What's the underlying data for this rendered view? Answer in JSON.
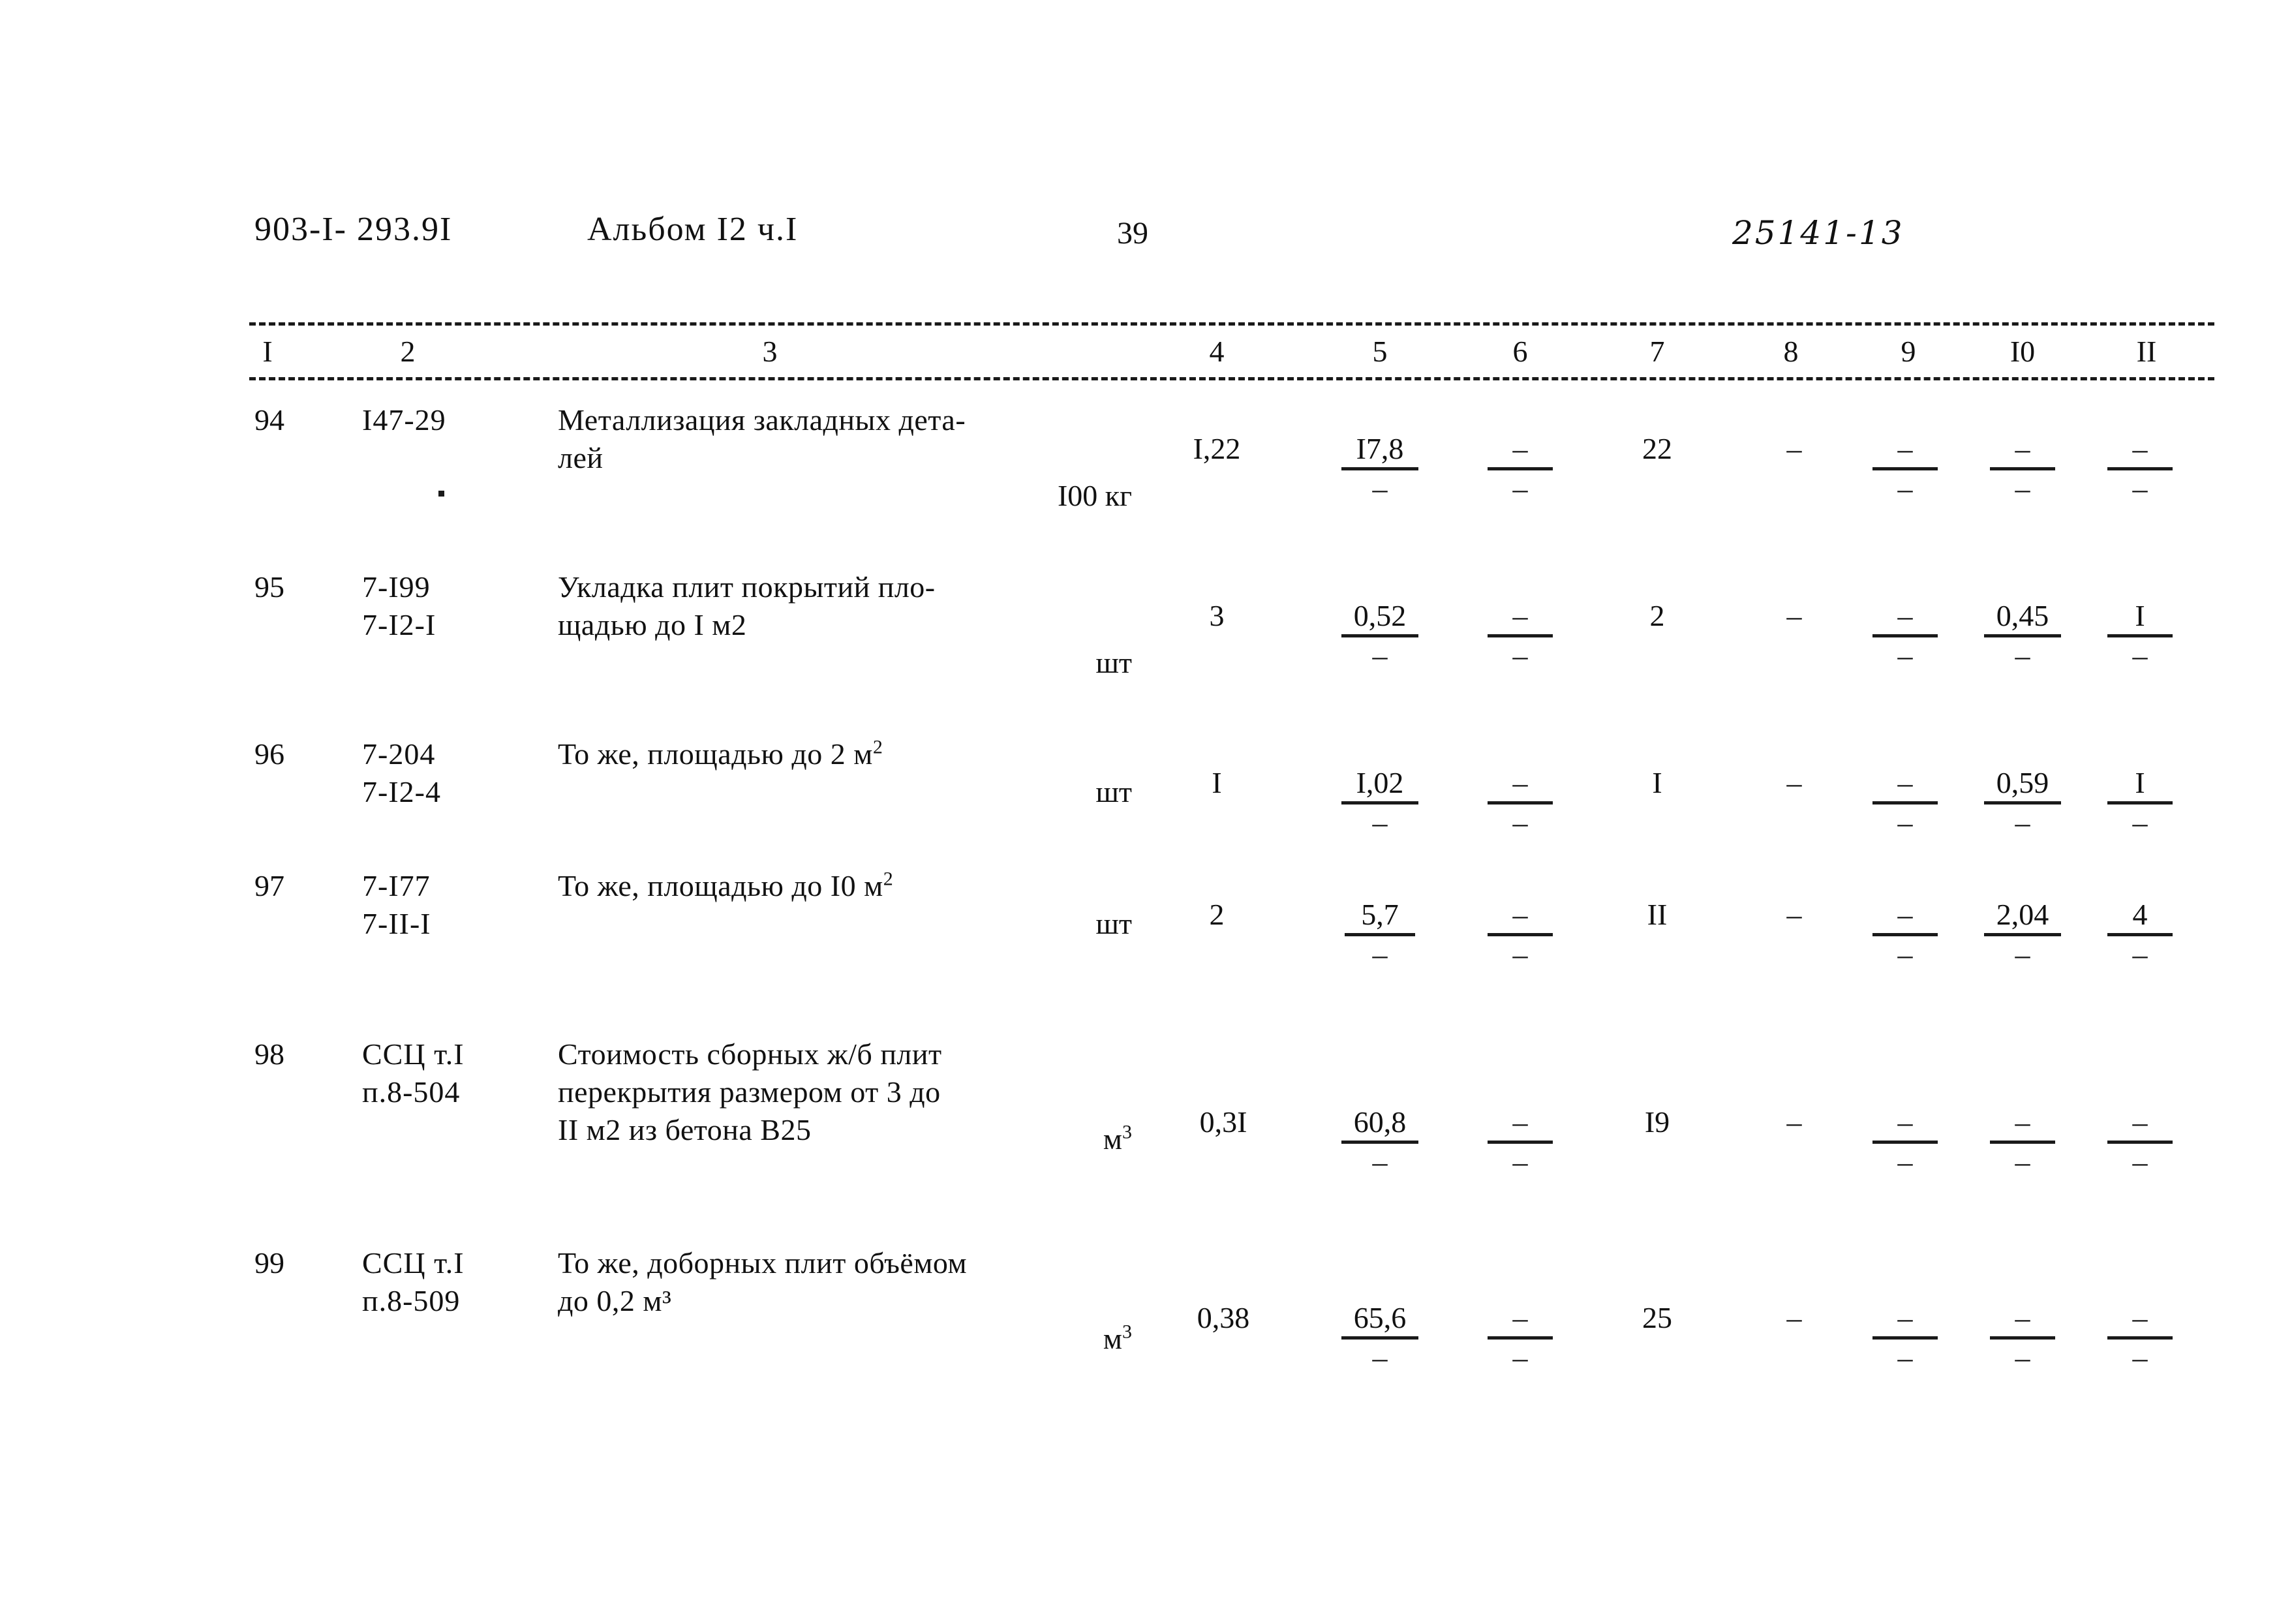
{
  "header": {
    "doc_code": "903-I- 293.9I",
    "album": "Альбом I2 ч.I",
    "page_number": "39",
    "stamp": "25141-13"
  },
  "table": {
    "column_headers": [
      "I",
      "2",
      "3",
      "4",
      "5",
      "6",
      "7",
      "8",
      "9",
      "I0",
      "II"
    ],
    "rows": [
      {
        "num": "94",
        "code_line1": "I47-29",
        "code_line2": "",
        "text_line1": "Металлизация закладных дета-",
        "text_line2": "лей",
        "text_line3": "",
        "unit": "I00 кг",
        "unit_sup": "",
        "col4": "I,22",
        "col5_num": "I7,8",
        "col5_den": "–",
        "col6_num": "–",
        "col6_den": "–",
        "col7": "22",
        "col8": "–",
        "col9_num": "–",
        "col9_den": "–",
        "col10_num": "–",
        "col10_den": "–",
        "col11_num": "–",
        "col11_den": "–"
      },
      {
        "num": "95",
        "code_line1": "7-I99",
        "code_line2": "7-I2-I",
        "text_line1": "Укладка плит покрытий пло-",
        "text_line2": "щадью до I м2",
        "text_line3": "",
        "unit": "шт",
        "unit_sup": "",
        "col4": "3",
        "col5_num": "0,52",
        "col5_den": "–",
        "col6_num": "–",
        "col6_den": "–",
        "col7": "2",
        "col8": "–",
        "col9_num": "–",
        "col9_den": "–",
        "col10_num": "0,45",
        "col10_den": "–",
        "col11_num": "I",
        "col11_den": "–"
      },
      {
        "num": "96",
        "code_line1": "7-204",
        "code_line2": "7-I2-4",
        "text_line1": "То же, площадью до 2 м",
        "text_line2": "",
        "text_line3": "",
        "unit": "шт",
        "unit_sup": "2",
        "col4": "I",
        "col5_num": "I,02",
        "col5_den": "–",
        "col6_num": "–",
        "col6_den": "–",
        "col7": "I",
        "col8": "–",
        "col9_num": "–",
        "col9_den": "–",
        "col10_num": "0,59",
        "col10_den": "–",
        "col11_num": "I",
        "col11_den": "–"
      },
      {
        "num": "97",
        "code_line1": "7-I77",
        "code_line2": "7-II-I",
        "text_line1": "То же, площадью до I0 м",
        "text_line2": "",
        "text_line3": "",
        "unit": "шт",
        "unit_sup": "2",
        "col4": "2",
        "col5_num": "5,7",
        "col5_den": "–",
        "col6_num": "–",
        "col6_den": "–",
        "col7": "II",
        "col8": "–",
        "col9_num": "–",
        "col9_den": "–",
        "col10_num": "2,04",
        "col10_den": "–",
        "col11_num": "4",
        "col11_den": "–"
      },
      {
        "num": "98",
        "code_line1": "ССЦ т.I",
        "code_line2": "п.8-504",
        "text_line1": "Стоимость сборных ж/б плит",
        "text_line2": "перекрытия размером от 3 до",
        "text_line3": "II м2 из бетона В25",
        "unit": "м",
        "unit_sup": "3",
        "col4": "0,3I",
        "col5_num": "60,8",
        "col5_den": "–",
        "col6_num": "–",
        "col6_den": "–",
        "col7": "I9",
        "col8": "–",
        "col9_num": "–",
        "col9_den": "–",
        "col10_num": "–",
        "col10_den": "–",
        "col11_num": "–",
        "col11_den": "–"
      },
      {
        "num": "99",
        "code_line1": "ССЦ т.I",
        "code_line2": "п.8-509",
        "text_line1": "То же, доборных плит объёмом",
        "text_line2": "до 0,2 м³",
        "text_line3": "",
        "unit": "м",
        "unit_sup": "3",
        "col4": "0,38",
        "col5_num": "65,6",
        "col5_den": "–",
        "col6_num": "–",
        "col6_den": "–",
        "col7": "25",
        "col8": "–",
        "col9_num": "–",
        "col9_den": "–",
        "col10_num": "–",
        "col10_den": "–",
        "col11_num": "–",
        "col11_den": "–"
      }
    ]
  }
}
